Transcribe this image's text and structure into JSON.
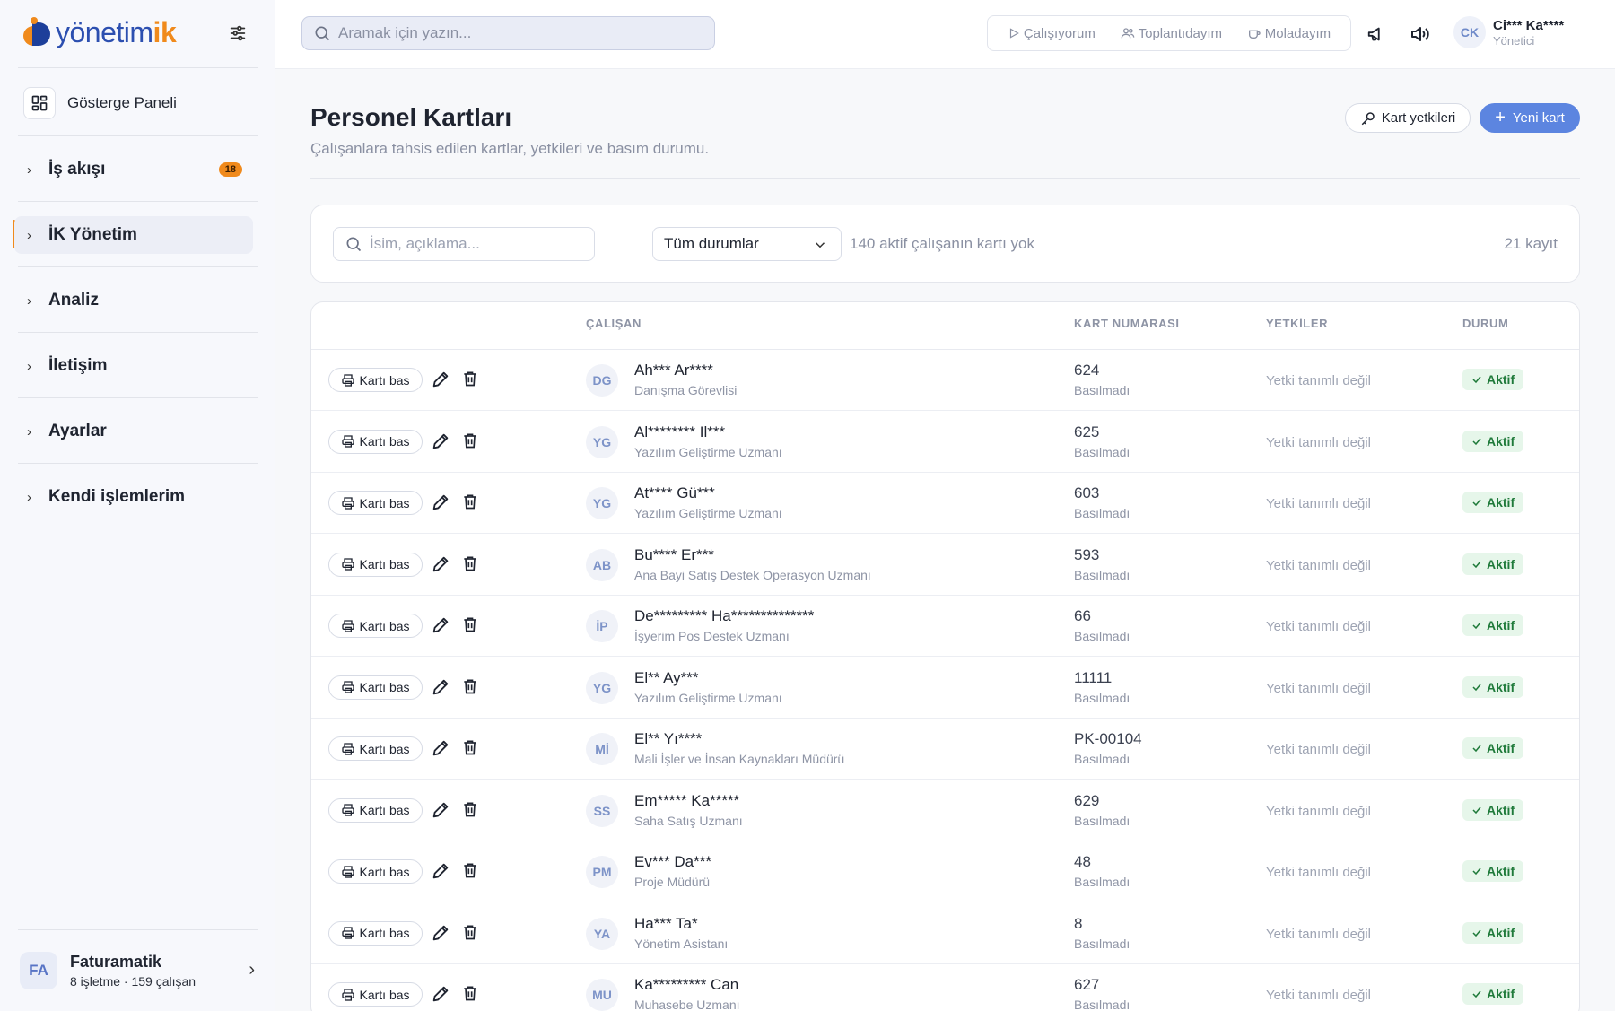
{
  "brand": {
    "name_main": "yönetim",
    "name_accent": "ik"
  },
  "sidebar": {
    "dashboard_label": "Gösterge Paneli",
    "items": [
      {
        "label": "İş akışı",
        "badge": "18"
      },
      {
        "label": "İK Yönetim"
      },
      {
        "label": "Analiz"
      },
      {
        "label": "İletişim"
      },
      {
        "label": "Ayarlar"
      },
      {
        "label": "Kendi işlemlerim"
      }
    ],
    "company": {
      "initials": "FA",
      "name": "Faturamatik",
      "meta": "8 işletme · 159 çalışan"
    }
  },
  "topbar": {
    "search_placeholder": "Aramak için yazın...",
    "status": [
      "Çalışıyorum",
      "Toplantıdayım",
      "Moladayım"
    ],
    "user": {
      "initials": "CK",
      "name": "Ci*** Ka****",
      "role": "Yönetici"
    }
  },
  "page": {
    "title": "Personel Kartları",
    "subtitle": "Çalışanlara tahsis edilen kartlar, yetkileri ve basım durumu.",
    "perm_button": "Kart yetkileri",
    "new_button": "Yeni kart"
  },
  "filters": {
    "search_placeholder": "İsim, açıklama...",
    "status_select": "Tüm durumlar",
    "note": "140 aktif çalışanın kartı yok",
    "count": "21 kayıt"
  },
  "table": {
    "headers": {
      "employee": "ÇALIŞAN",
      "card_no": "KART NUMARASI",
      "perms": "YETKİLER",
      "status": "DURUM"
    },
    "print_label": "Kartı bas",
    "rows": [
      {
        "initials": "DG",
        "name": "Ah*** Ar****",
        "title": "Danışma Görevlisi",
        "card_no": "624",
        "card_status": "Basılmadı",
        "perms": "Yetki tanımlı değil",
        "status": "Aktif"
      },
      {
        "initials": "YG",
        "name": "Al******** Il***",
        "title": "Yazılım Geliştirme Uzmanı",
        "card_no": "625",
        "card_status": "Basılmadı",
        "perms": "Yetki tanımlı değil",
        "status": "Aktif"
      },
      {
        "initials": "YG",
        "name": "At**** Gü***",
        "title": "Yazılım Geliştirme Uzmanı",
        "card_no": "603",
        "card_status": "Basılmadı",
        "perms": "Yetki tanımlı değil",
        "status": "Aktif"
      },
      {
        "initials": "AB",
        "name": "Bu**** Er***",
        "title": "Ana Bayi Satış Destek Operasyon Uzmanı",
        "card_no": "593",
        "card_status": "Basılmadı",
        "perms": "Yetki tanımlı değil",
        "status": "Aktif"
      },
      {
        "initials": "İP",
        "name": "De********* Ha**************",
        "title": "İşyerim Pos Destek Uzmanı",
        "card_no": "66",
        "card_status": "Basılmadı",
        "perms": "Yetki tanımlı değil",
        "status": "Aktif"
      },
      {
        "initials": "YG",
        "name": "El** Ay***",
        "title": "Yazılım Geliştirme Uzmanı",
        "card_no": "11111",
        "card_status": "Basılmadı",
        "perms": "Yetki tanımlı değil",
        "status": "Aktif"
      },
      {
        "initials": "Mİ",
        "name": "El** Yı****",
        "title": "Mali İşler ve İnsan Kaynakları Müdürü",
        "card_no": "PK-00104",
        "card_status": "Basılmadı",
        "perms": "Yetki tanımlı değil",
        "status": "Aktif"
      },
      {
        "initials": "SS",
        "name": "Em***** Ka*****",
        "title": "Saha Satış Uzmanı",
        "card_no": "629",
        "card_status": "Basılmadı",
        "perms": "Yetki tanımlı değil",
        "status": "Aktif"
      },
      {
        "initials": "PM",
        "name": "Ev*** Da***",
        "title": "Proje Müdürü",
        "card_no": "48",
        "card_status": "Basılmadı",
        "perms": "Yetki tanımlı değil",
        "status": "Aktif"
      },
      {
        "initials": "YA",
        "name": "Ha*** Ta*",
        "title": "Yönetim Asistanı",
        "card_no": "8",
        "card_status": "Basılmadı",
        "perms": "Yetki tanımlı değil",
        "status": "Aktif"
      },
      {
        "initials": "MU",
        "name": "Ka********* Can",
        "title": "Muhasebe Uzmanı",
        "card_no": "627",
        "card_status": "Basılmadı",
        "perms": "Yetki tanımlı değil",
        "status": "Aktif"
      }
    ]
  }
}
